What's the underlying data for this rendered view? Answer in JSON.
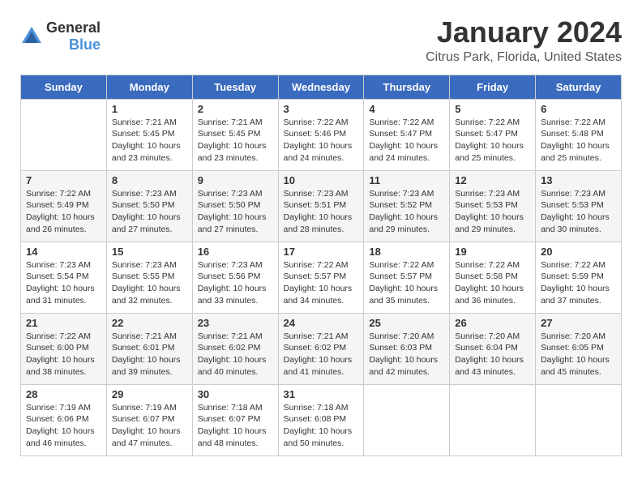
{
  "logo": {
    "general": "General",
    "blue": "Blue"
  },
  "header": {
    "month": "January 2024",
    "location": "Citrus Park, Florida, United States"
  },
  "days_of_week": [
    "Sunday",
    "Monday",
    "Tuesday",
    "Wednesday",
    "Thursday",
    "Friday",
    "Saturday"
  ],
  "weeks": [
    [
      {
        "day": "",
        "info": ""
      },
      {
        "day": "1",
        "info": "Sunrise: 7:21 AM\nSunset: 5:45 PM\nDaylight: 10 hours\nand 23 minutes."
      },
      {
        "day": "2",
        "info": "Sunrise: 7:21 AM\nSunset: 5:45 PM\nDaylight: 10 hours\nand 23 minutes."
      },
      {
        "day": "3",
        "info": "Sunrise: 7:22 AM\nSunset: 5:46 PM\nDaylight: 10 hours\nand 24 minutes."
      },
      {
        "day": "4",
        "info": "Sunrise: 7:22 AM\nSunset: 5:47 PM\nDaylight: 10 hours\nand 24 minutes."
      },
      {
        "day": "5",
        "info": "Sunrise: 7:22 AM\nSunset: 5:47 PM\nDaylight: 10 hours\nand 25 minutes."
      },
      {
        "day": "6",
        "info": "Sunrise: 7:22 AM\nSunset: 5:48 PM\nDaylight: 10 hours\nand 25 minutes."
      }
    ],
    [
      {
        "day": "7",
        "info": "Sunrise: 7:22 AM\nSunset: 5:49 PM\nDaylight: 10 hours\nand 26 minutes."
      },
      {
        "day": "8",
        "info": "Sunrise: 7:23 AM\nSunset: 5:50 PM\nDaylight: 10 hours\nand 27 minutes."
      },
      {
        "day": "9",
        "info": "Sunrise: 7:23 AM\nSunset: 5:50 PM\nDaylight: 10 hours\nand 27 minutes."
      },
      {
        "day": "10",
        "info": "Sunrise: 7:23 AM\nSunset: 5:51 PM\nDaylight: 10 hours\nand 28 minutes."
      },
      {
        "day": "11",
        "info": "Sunrise: 7:23 AM\nSunset: 5:52 PM\nDaylight: 10 hours\nand 29 minutes."
      },
      {
        "day": "12",
        "info": "Sunrise: 7:23 AM\nSunset: 5:53 PM\nDaylight: 10 hours\nand 29 minutes."
      },
      {
        "day": "13",
        "info": "Sunrise: 7:23 AM\nSunset: 5:53 PM\nDaylight: 10 hours\nand 30 minutes."
      }
    ],
    [
      {
        "day": "14",
        "info": "Sunrise: 7:23 AM\nSunset: 5:54 PM\nDaylight: 10 hours\nand 31 minutes."
      },
      {
        "day": "15",
        "info": "Sunrise: 7:23 AM\nSunset: 5:55 PM\nDaylight: 10 hours\nand 32 minutes."
      },
      {
        "day": "16",
        "info": "Sunrise: 7:23 AM\nSunset: 5:56 PM\nDaylight: 10 hours\nand 33 minutes."
      },
      {
        "day": "17",
        "info": "Sunrise: 7:22 AM\nSunset: 5:57 PM\nDaylight: 10 hours\nand 34 minutes."
      },
      {
        "day": "18",
        "info": "Sunrise: 7:22 AM\nSunset: 5:57 PM\nDaylight: 10 hours\nand 35 minutes."
      },
      {
        "day": "19",
        "info": "Sunrise: 7:22 AM\nSunset: 5:58 PM\nDaylight: 10 hours\nand 36 minutes."
      },
      {
        "day": "20",
        "info": "Sunrise: 7:22 AM\nSunset: 5:59 PM\nDaylight: 10 hours\nand 37 minutes."
      }
    ],
    [
      {
        "day": "21",
        "info": "Sunrise: 7:22 AM\nSunset: 6:00 PM\nDaylight: 10 hours\nand 38 minutes."
      },
      {
        "day": "22",
        "info": "Sunrise: 7:21 AM\nSunset: 6:01 PM\nDaylight: 10 hours\nand 39 minutes."
      },
      {
        "day": "23",
        "info": "Sunrise: 7:21 AM\nSunset: 6:02 PM\nDaylight: 10 hours\nand 40 minutes."
      },
      {
        "day": "24",
        "info": "Sunrise: 7:21 AM\nSunset: 6:02 PM\nDaylight: 10 hours\nand 41 minutes."
      },
      {
        "day": "25",
        "info": "Sunrise: 7:20 AM\nSunset: 6:03 PM\nDaylight: 10 hours\nand 42 minutes."
      },
      {
        "day": "26",
        "info": "Sunrise: 7:20 AM\nSunset: 6:04 PM\nDaylight: 10 hours\nand 43 minutes."
      },
      {
        "day": "27",
        "info": "Sunrise: 7:20 AM\nSunset: 6:05 PM\nDaylight: 10 hours\nand 45 minutes."
      }
    ],
    [
      {
        "day": "28",
        "info": "Sunrise: 7:19 AM\nSunset: 6:06 PM\nDaylight: 10 hours\nand 46 minutes."
      },
      {
        "day": "29",
        "info": "Sunrise: 7:19 AM\nSunset: 6:07 PM\nDaylight: 10 hours\nand 47 minutes."
      },
      {
        "day": "30",
        "info": "Sunrise: 7:18 AM\nSunset: 6:07 PM\nDaylight: 10 hours\nand 48 minutes."
      },
      {
        "day": "31",
        "info": "Sunrise: 7:18 AM\nSunset: 6:08 PM\nDaylight: 10 hours\nand 50 minutes."
      },
      {
        "day": "",
        "info": ""
      },
      {
        "day": "",
        "info": ""
      },
      {
        "day": "",
        "info": ""
      }
    ]
  ]
}
